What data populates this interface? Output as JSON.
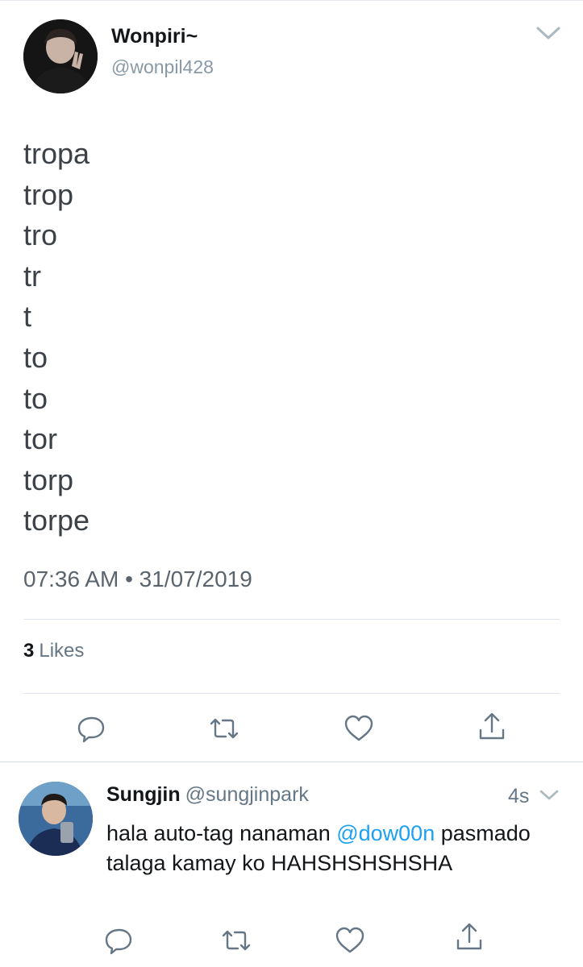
{
  "tweet": {
    "author": {
      "display_name": "Wonpiri~",
      "handle": "@wonpil428",
      "avatar": "user-avatar"
    },
    "menu_icon": "chevron-down-icon",
    "lines": [
      "tropa",
      "trop",
      "tro",
      "tr",
      "t",
      "to",
      "to",
      "tor",
      "torp",
      "torpe"
    ],
    "timestamp": "07:36 AM • 31/07/2019",
    "likes": {
      "count": "3",
      "label": "Likes"
    },
    "actions": [
      "reply-icon",
      "retweet-icon",
      "like-icon",
      "share-icon"
    ]
  },
  "reply": {
    "author": {
      "display_name": "Sungjin",
      "handle": "@sungjinpark",
      "avatar": "user-avatar"
    },
    "time": "4s",
    "menu_icon": "chevron-down-icon",
    "text_before_mention": "hala auto-tag nanaman ",
    "mention": "@dow00n",
    "text_after_mention": " pasmado talaga kamay ko HAHSHSHSHSHA",
    "actions": [
      "reply-icon",
      "retweet-icon",
      "like-icon",
      "share-icon"
    ]
  },
  "colors": {
    "mention": "#1da1f2",
    "secondary_text": "#657786",
    "icon": "#657786",
    "divider": "#e6ecf0"
  }
}
